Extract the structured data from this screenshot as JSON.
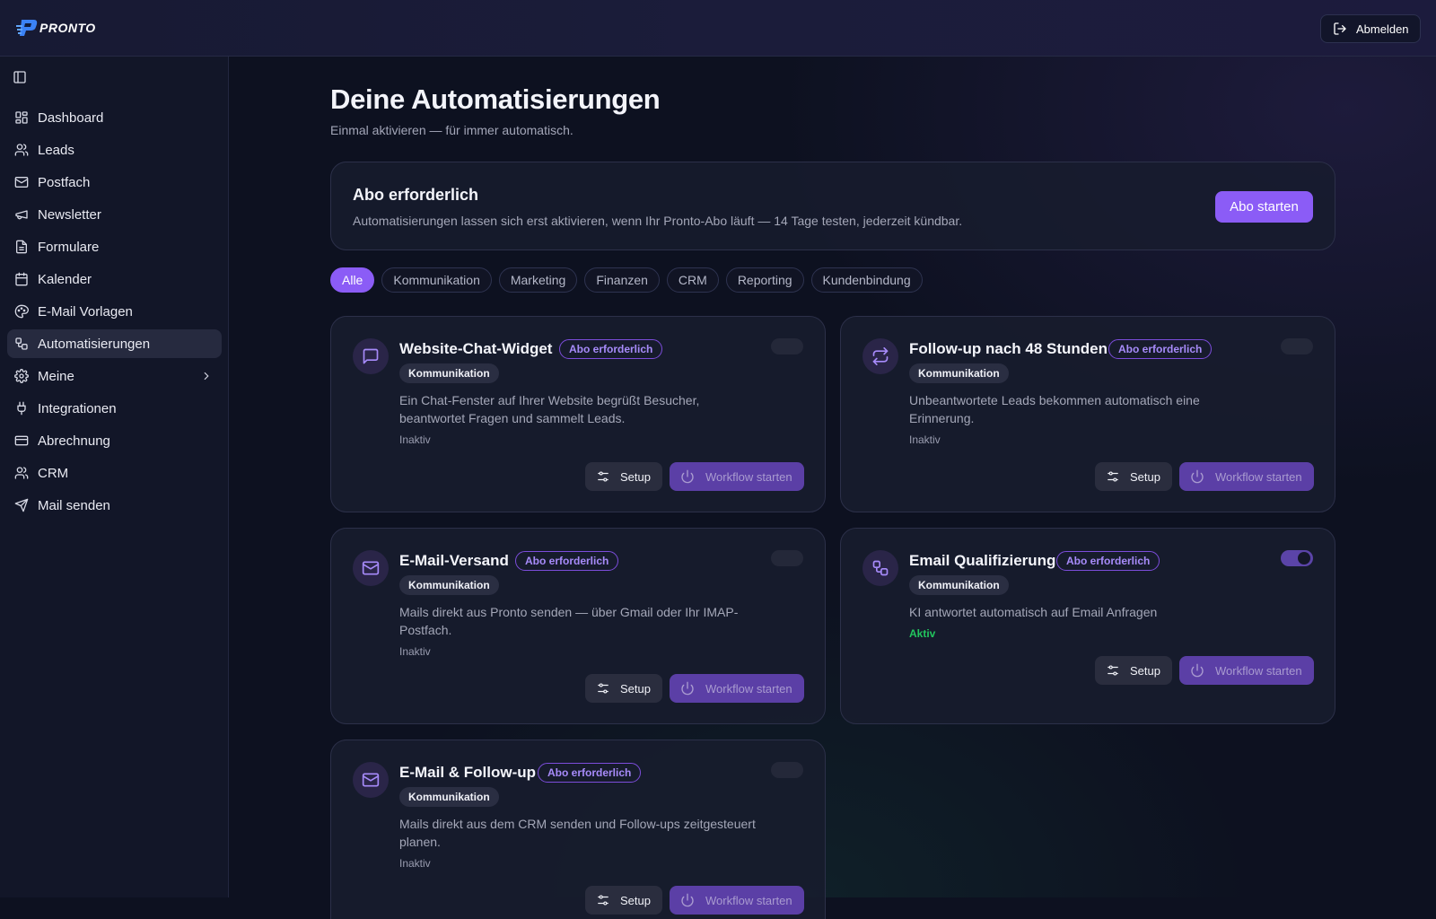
{
  "app": {
    "logo_text": "PRONTO"
  },
  "header": {
    "logout_label": "Abmelden"
  },
  "sidebar": {
    "items": [
      {
        "label": "Dashboard",
        "icon": "dashboard-icon",
        "active": false
      },
      {
        "label": "Leads",
        "icon": "users-icon",
        "active": false
      },
      {
        "label": "Postfach",
        "icon": "mail-icon",
        "active": false
      },
      {
        "label": "Newsletter",
        "icon": "megaphone-icon",
        "active": false
      },
      {
        "label": "Formulare",
        "icon": "file-text-icon",
        "active": false
      },
      {
        "label": "Kalender",
        "icon": "calendar-icon",
        "active": false
      },
      {
        "label": "E-Mail Vorlagen",
        "icon": "palette-icon",
        "active": false
      },
      {
        "label": "Automatisierungen",
        "icon": "workflow-icon",
        "active": true
      },
      {
        "label": "Meine",
        "icon": "gear-icon",
        "active": false,
        "has_submenu": true
      },
      {
        "label": "Integrationen",
        "icon": "plug-icon",
        "active": false
      },
      {
        "label": "Abrechnung",
        "icon": "credit-card-icon",
        "active": false
      },
      {
        "label": "CRM",
        "icon": "users-icon",
        "active": false
      },
      {
        "label": "Mail senden",
        "icon": "send-icon",
        "active": false
      }
    ]
  },
  "main": {
    "title": "Deine Automatisierungen",
    "subtitle": "Einmal aktivieren — für immer automatisch.",
    "banner": {
      "title": "Abo erforderlich",
      "text": "Automatisierungen lassen sich erst aktivieren, wenn Ihr Pronto-Abo läuft — 14 Tage testen, jederzeit kündbar.",
      "button": "Abo starten"
    },
    "filters": [
      "Alle",
      "Kommunikation",
      "Marketing",
      "Finanzen",
      "CRM",
      "Reporting",
      "Kundenbindung"
    ],
    "active_filter": "Alle",
    "cards": [
      {
        "title": "Website-Chat-Widget",
        "badge": "Abo erforderlich",
        "category": "Kommunikation",
        "description": "Ein Chat-Fenster auf Ihrer Website begrüßt Besucher, beantwortet Fragen und sammelt Leads.",
        "status": "Inaktiv",
        "enabled": false,
        "icon": "chat-icon",
        "setup_label": "Setup",
        "workflow_label": "Workflow starten"
      },
      {
        "title": "Follow-up nach 48 Stunden",
        "badge": "Abo erforderlich",
        "category": "Kommunikation",
        "description": "Unbeantwortete Leads bekommen automatisch eine Erinnerung.",
        "status": "Inaktiv",
        "enabled": false,
        "icon": "repeat-icon",
        "setup_label": "Setup",
        "workflow_label": "Workflow starten"
      },
      {
        "title": "E-Mail-Versand",
        "badge": "Abo erforderlich",
        "category": "Kommunikation",
        "description": "Mails direkt aus Pronto senden — über Gmail oder Ihr IMAP-Postfach.",
        "status": "Inaktiv",
        "enabled": false,
        "icon": "mail-icon",
        "setup_label": "Setup",
        "workflow_label": "Workflow starten"
      },
      {
        "title": "Email Qualifizierung",
        "badge": "Abo erforderlich",
        "category": "Kommunikation",
        "description": "KI antwortet automatisch auf Email Anfragen",
        "status": "Aktiv",
        "enabled": true,
        "icon": "workflow-icon",
        "setup_label": "Setup",
        "workflow_label": "Workflow starten"
      },
      {
        "title": "E-Mail & Follow-up",
        "badge": "Abo erforderlich",
        "category": "Kommunikation",
        "description": "Mails direkt aus dem CRM senden und Follow-ups zeitgesteuert planen.",
        "status": "Inaktiv",
        "enabled": false,
        "icon": "mail-icon",
        "setup_label": "Setup",
        "workflow_label": "Workflow starten"
      }
    ]
  },
  "colors": {
    "accent": "#8b5cf6",
    "active_status": "#22c55e",
    "background": "#0d1120"
  }
}
